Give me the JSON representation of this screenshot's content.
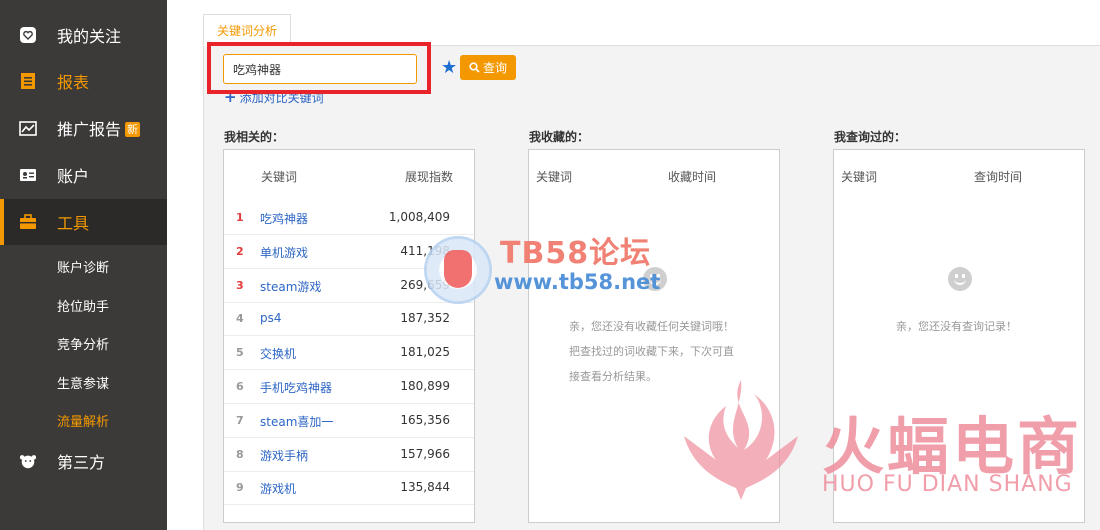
{
  "sidebar": {
    "items": [
      {
        "label": "我的关注",
        "icon": "heart-icon"
      },
      {
        "label": "报表",
        "icon": "report-icon"
      },
      {
        "label": "推广报告",
        "icon": "chart-icon",
        "badge": "新"
      },
      {
        "label": "账户",
        "icon": "id-card-icon"
      },
      {
        "label": "工具",
        "icon": "toolbox-icon"
      },
      {
        "label": "第三方",
        "icon": "third-party-icon"
      }
    ],
    "subitems": [
      {
        "label": "账户诊断"
      },
      {
        "label": "抢位助手"
      },
      {
        "label": "竞争分析"
      },
      {
        "label": "生意参谋"
      },
      {
        "label": "流量解析"
      }
    ]
  },
  "tab": {
    "label": "关键词分析"
  },
  "search": {
    "value": "吃鸡神器",
    "button_label": "查询",
    "add_compare": "添加对比关键词"
  },
  "related": {
    "title": "我相关的：",
    "col_keyword": "关键词",
    "col_index": "展现指数",
    "rows": [
      {
        "rank": "1",
        "keyword": "吃鸡神器",
        "value": "1,008,409"
      },
      {
        "rank": "2",
        "keyword": "单机游戏",
        "value": "411,198"
      },
      {
        "rank": "3",
        "keyword": "steam游戏",
        "value": "269,659"
      },
      {
        "rank": "4",
        "keyword": "ps4",
        "value": "187,352"
      },
      {
        "rank": "5",
        "keyword": "交换机",
        "value": "181,025"
      },
      {
        "rank": "6",
        "keyword": "手机吃鸡神器",
        "value": "180,899"
      },
      {
        "rank": "7",
        "keyword": "steam喜加一",
        "value": "165,356"
      },
      {
        "rank": "8",
        "keyword": "游戏手柄",
        "value": "157,966"
      },
      {
        "rank": "9",
        "keyword": "游戏机",
        "value": "135,844"
      }
    ]
  },
  "favorites": {
    "title": "我收藏的：",
    "col_keyword": "关键词",
    "col_time": "收藏时间",
    "empty_line1": "亲，您还没有收藏任何关键词哦！",
    "empty_line2": "把查找过的词收藏下来，下次可直",
    "empty_line3": "接查看分析结果。"
  },
  "history": {
    "title": "我查询过的：",
    "col_keyword": "关键词",
    "col_time": "查询时间",
    "empty_text": "亲，您还没有查询记录！"
  },
  "watermarks": {
    "forum": "TB58论坛",
    "url": "www.tb58.net",
    "brand_cn": "火蝠电商",
    "brand_en": "HUO FU DIAN SHANG"
  },
  "colors": {
    "accent": "#f39800",
    "link": "#2d66c4",
    "sidebar": "#3c3a38",
    "highlight": "#e8232a"
  }
}
